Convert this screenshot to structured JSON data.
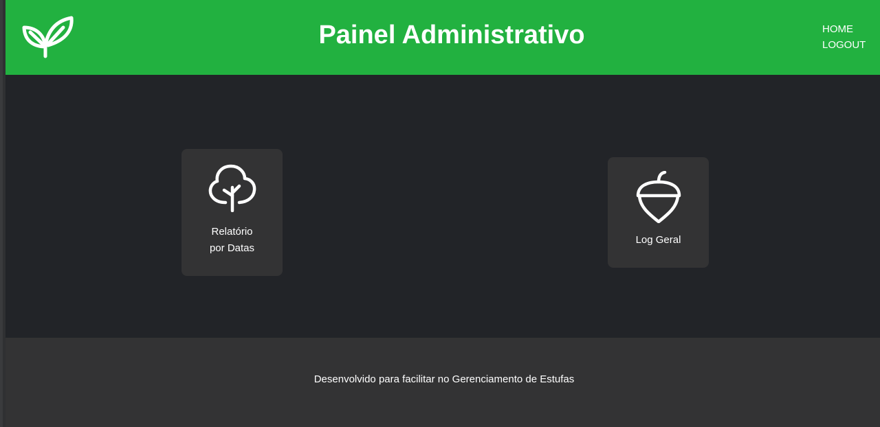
{
  "header": {
    "logo_icon": "sprout-leaves-icon",
    "title": "Painel Administrativo",
    "nav": [
      {
        "label": "HOME"
      },
      {
        "label": "LOGOUT"
      }
    ],
    "background_color": "#22b140"
  },
  "main": {
    "background_color": "#222428",
    "cards": [
      {
        "icon": "tree-icon",
        "label_line1": "Relatório",
        "label_line2": "por Datas"
      },
      {
        "icon": "acorn-icon",
        "label": "Log Geral"
      }
    ]
  },
  "footer": {
    "text": "Desenvolvido para facilitar no Gerenciamento de Estufas",
    "background_color": "#333334"
  }
}
